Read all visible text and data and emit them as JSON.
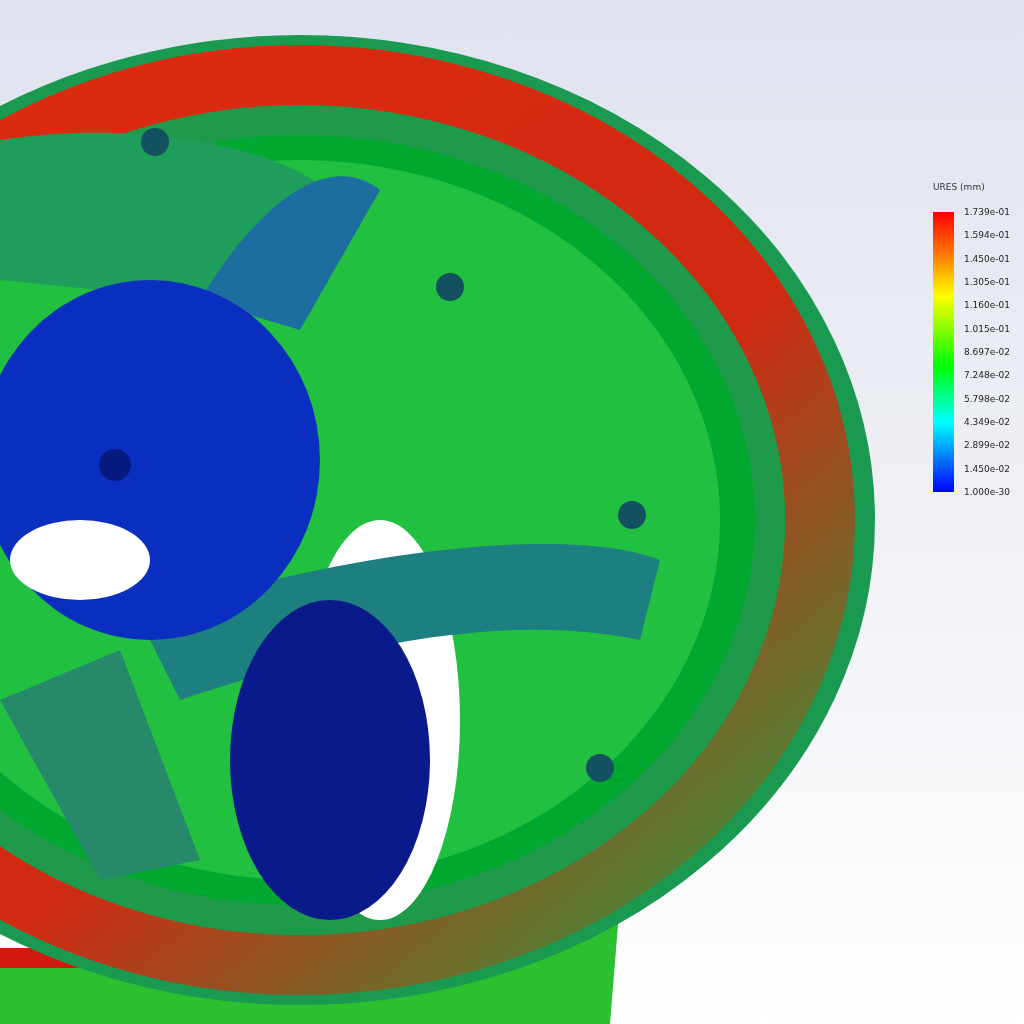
{
  "legend": {
    "title": "URES (mm)",
    "labels": [
      "1.739e-01",
      "1.594e-01",
      "1.450e-01",
      "1.305e-01",
      "1.160e-01",
      "1.015e-01",
      "8.697e-02",
      "7.248e-02",
      "5.798e-02",
      "4.349e-02",
      "2.899e-02",
      "1.450e-02",
      "1.000e-30"
    ]
  }
}
